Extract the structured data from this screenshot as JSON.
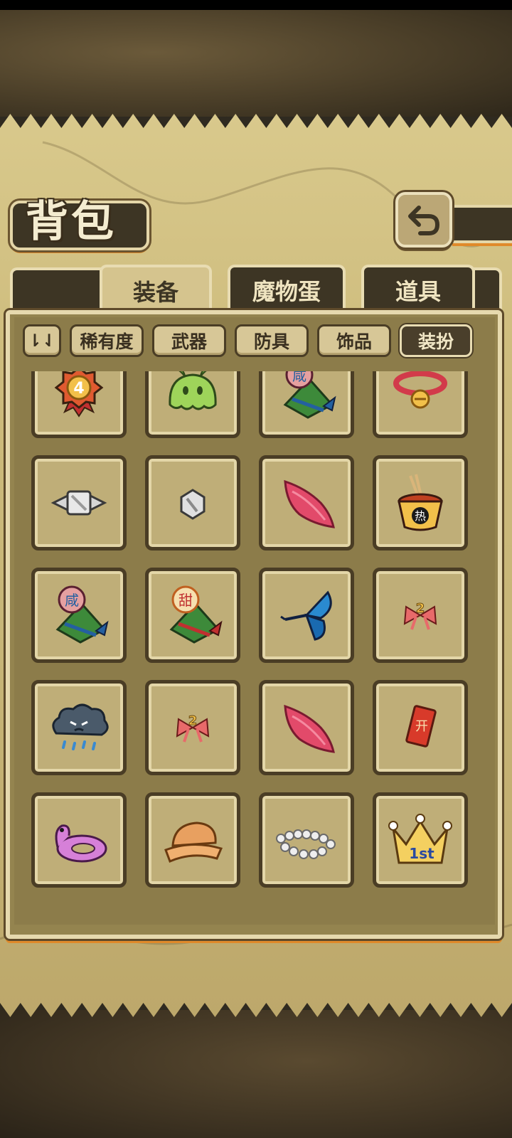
{
  "screen": {
    "title": "背包"
  },
  "tabs": [
    {
      "label": "装备",
      "active": true
    },
    {
      "label": "魔物蛋",
      "active": false
    },
    {
      "label": "道具",
      "active": false
    }
  ],
  "filters": {
    "sort_label": "⇂⇃",
    "items": [
      {
        "label": "稀有度",
        "active": false
      },
      {
        "label": "武器",
        "active": false
      },
      {
        "label": "防具",
        "active": false
      },
      {
        "label": "饰品",
        "active": false
      },
      {
        "label": "装扮",
        "active": true
      }
    ]
  },
  "inventory": {
    "rows": [
      [
        "medal-4-icon",
        "green-slime-hat-icon",
        "zongzi-salty-icon",
        "cat-bell-collar-icon"
      ],
      [
        "silver-wing-badge-icon",
        "silver-gem-icon",
        "pink-tutu-icon",
        "noodle-cup-icon"
      ],
      [
        "zongzi-salty-icon",
        "zongzi-sweet-icon",
        "blue-butterfly-icon",
        "bow-2-icon"
      ],
      [
        "rain-cloud-icon",
        "bow-2-icon",
        "pink-tutu-icon",
        "red-talisman-icon"
      ],
      [
        "pink-swim-ring-icon",
        "straw-hat-icon",
        "pearl-necklace-icon",
        "gold-crown-1st-icon"
      ]
    ],
    "badge_texts": {
      "medal": "4",
      "salty": "咸",
      "sweet": "甜",
      "noodle": "热",
      "crown": "1st",
      "talisman": "开"
    }
  },
  "colors": {
    "accent_orange": "#e08a2a",
    "panel_dark": "#3d3524",
    "parchment": "#d5c48e"
  }
}
